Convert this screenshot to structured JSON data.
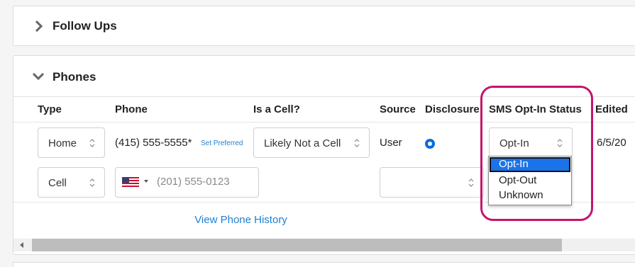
{
  "followups": {
    "title": "Follow Ups"
  },
  "phones": {
    "title": "Phones",
    "columns": {
      "type": "Type",
      "phone": "Phone",
      "is_cell": "Is a Cell?",
      "source": "Source",
      "disclosure": "Disclosure",
      "sms_status": "SMS Opt-In Status",
      "edited": "Edited"
    },
    "row1": {
      "type": "Home",
      "phone": "(415) 555-5555*",
      "set_preferred": "Set Preferred",
      "is_cell": "Likely Not a Cell",
      "source": "User",
      "sms_status": "Opt-In",
      "edited": "6/5/20"
    },
    "row2": {
      "type": "Cell",
      "phone_placeholder": "(201) 555-0123"
    },
    "sms_options": [
      "Opt-In",
      "Opt-Out",
      "Unknown"
    ],
    "view_history": "View Phone History"
  },
  "colors": {
    "link": "#1f7fd1",
    "radio": "#0a6cdb",
    "highlight": "#c4146e",
    "selected_option": "#1a73e8"
  },
  "icons": [
    "chevron-right-icon",
    "chevron-down-icon",
    "select-arrows-icon",
    "us-flag-icon"
  ]
}
